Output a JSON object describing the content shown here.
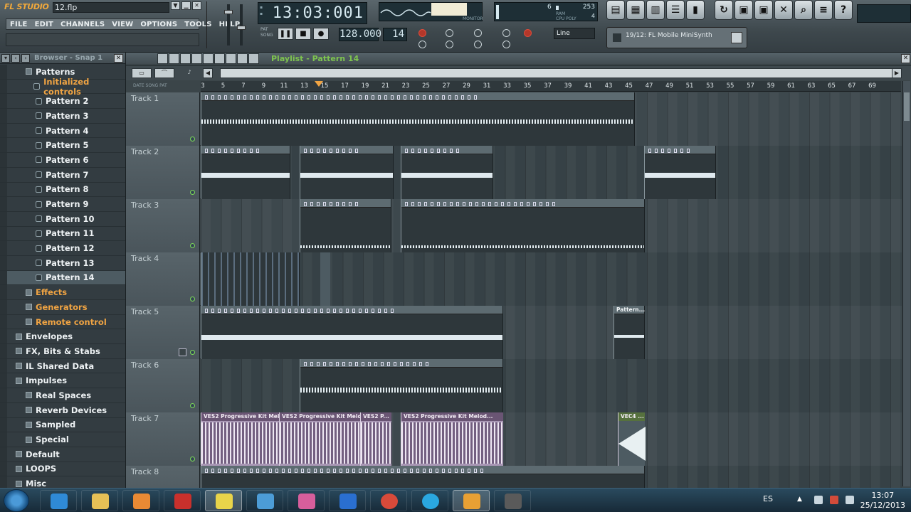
{
  "title_bar": {
    "logo": "FL STUDIO",
    "filename": "12.flp"
  },
  "menu": [
    "FILE",
    "EDIT",
    "CHANNELS",
    "VIEW",
    "OPTIONS",
    "TOOLS",
    "HELP"
  ],
  "clock_display": "13:03:001",
  "tempo": "128.000",
  "pattern_number": "14",
  "snap_mode": "Line",
  "cpu": {
    "value1": "6",
    "value2": "253",
    "poly": "4"
  },
  "channel_selector": "19/12: FL Mobile MiniSynth",
  "browser": {
    "title": "Browser - Snap 1",
    "items": [
      {
        "label": "Patterns",
        "type": "folder"
      },
      {
        "label": "Initialized controls",
        "type": "pattern",
        "style": "orange"
      },
      {
        "label": "Pattern 2",
        "type": "pattern"
      },
      {
        "label": "Pattern 3",
        "type": "pattern"
      },
      {
        "label": "Pattern 4",
        "type": "pattern"
      },
      {
        "label": "Pattern 5",
        "type": "pattern"
      },
      {
        "label": "Pattern 6",
        "type": "pattern"
      },
      {
        "label": "Pattern 7",
        "type": "pattern"
      },
      {
        "label": "Pattern 8",
        "type": "pattern"
      },
      {
        "label": "Pattern 9",
        "type": "pattern"
      },
      {
        "label": "Pattern 10",
        "type": "pattern"
      },
      {
        "label": "Pattern 11",
        "type": "pattern"
      },
      {
        "label": "Pattern 12",
        "type": "pattern"
      },
      {
        "label": "Pattern 13",
        "type": "pattern"
      },
      {
        "label": "Pattern 14",
        "type": "pattern",
        "selected": true
      },
      {
        "label": "Effects",
        "type": "folder",
        "style": "orange"
      },
      {
        "label": "Generators",
        "type": "folder",
        "style": "orange"
      },
      {
        "label": "Remote control",
        "type": "folder",
        "style": "orange"
      },
      {
        "label": "Envelopes",
        "type": "folder"
      },
      {
        "label": "FX, Bits & Stabs",
        "type": "folder"
      },
      {
        "label": "IL Shared Data",
        "type": "folder"
      },
      {
        "label": "Impulses",
        "type": "folder"
      },
      {
        "label": "Real Spaces",
        "type": "folder"
      },
      {
        "label": "Reverb Devices",
        "type": "folder"
      },
      {
        "label": "Sampled",
        "type": "folder"
      },
      {
        "label": "Special",
        "type": "folder"
      },
      {
        "label": "Default",
        "type": "folder"
      },
      {
        "label": "LOOPS",
        "type": "folder"
      },
      {
        "label": "Misc",
        "type": "folder"
      }
    ]
  },
  "playlist": {
    "title": "Playlist - Pattern 14",
    "ruler": [
      "3",
      "5",
      "7",
      "9",
      "11",
      "13",
      "15",
      "17",
      "19",
      "21",
      "23",
      "25",
      "27",
      "29",
      "31",
      "33",
      "35",
      "37",
      "39",
      "41",
      "43",
      "45",
      "47",
      "49",
      "51",
      "53",
      "55",
      "57",
      "59",
      "61",
      "63",
      "65",
      "67",
      "69"
    ],
    "header_labels": "DATE  SONG  PAT",
    "tracks": [
      "Track 1",
      "Track 2",
      "Track 3",
      "Track 4",
      "Track 5",
      "Track 6",
      "Track 7",
      "Track 8"
    ],
    "track7_clips": [
      "VES2 Progressive Kit Melod...",
      "VES2 Progressive Kit Melod...",
      "VES2 P...",
      "VES2 Progressive Kit Melod...",
      "VEC4 ..."
    ],
    "track5_label": "Pattern..."
  },
  "taskbar": {
    "language": "ES",
    "time": "13:07",
    "date": "25/12/2013"
  }
}
